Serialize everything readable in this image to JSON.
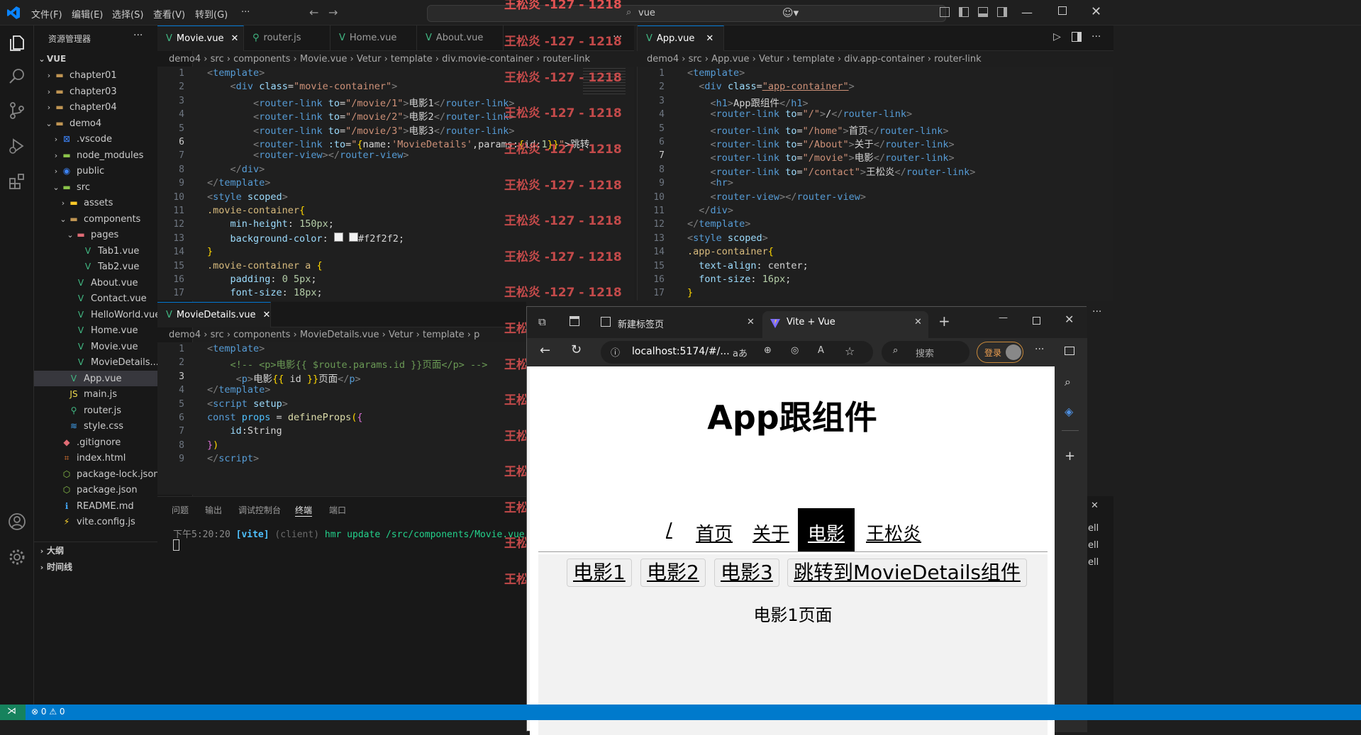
{
  "titlebar": {
    "menus": [
      "文件(F)",
      "编辑(E)",
      "选择(S)",
      "查看(V)",
      "转到(G)",
      "···"
    ],
    "search_text": "vue",
    "watermark_top": "王松炎 -127 - 1218"
  },
  "sidebar": {
    "title": "资源管理器",
    "root": "VUE",
    "items": [
      {
        "label": "chapter01"
      },
      {
        "label": "chapter03"
      },
      {
        "label": "chapter04"
      },
      {
        "label": "demo4"
      },
      {
        "label": ".vscode"
      },
      {
        "label": "node_modules"
      },
      {
        "label": "public"
      },
      {
        "label": "src"
      },
      {
        "label": "assets"
      },
      {
        "label": "components"
      },
      {
        "label": "pages"
      },
      {
        "label": "Tab1.vue"
      },
      {
        "label": "Tab2.vue"
      },
      {
        "label": "About.vue"
      },
      {
        "label": "Contact.vue"
      },
      {
        "label": "HelloWorld.vue"
      },
      {
        "label": "Home.vue"
      },
      {
        "label": "Movie.vue"
      },
      {
        "label": "MovieDetails...."
      },
      {
        "label": "App.vue"
      },
      {
        "label": "main.js"
      },
      {
        "label": "router.js"
      },
      {
        "label": "style.css"
      },
      {
        "label": ".gitignore"
      },
      {
        "label": "index.html"
      },
      {
        "label": "package-lock.json"
      },
      {
        "label": "package.json"
      },
      {
        "label": "README.md"
      },
      {
        "label": "vite.config.js"
      }
    ],
    "outline": "大纲",
    "timeline": "时间线"
  },
  "editor_left": {
    "tabs": [
      "Movie.vue",
      "router.js",
      "Home.vue",
      "About.vue"
    ],
    "breadcrumb": [
      "demo4",
      "src",
      "components",
      "Movie.vue",
      "Vetur",
      "template",
      "div.movie-container",
      "router-link"
    ]
  },
  "editor_right": {
    "tabs": [
      "App.vue"
    ],
    "breadcrumb": [
      "demo4",
      "src",
      "App.vue",
      "Vetur",
      "template",
      "div.app-container",
      "router-link"
    ]
  },
  "editor_bottom": {
    "tabs": [
      "MovieDetails.vue"
    ],
    "breadcrumb": [
      "demo4",
      "src",
      "components",
      "MovieDetails.vue",
      "Vetur",
      "template",
      "p"
    ]
  },
  "panel": {
    "tabs": [
      "问题",
      "输出",
      "调试控制台",
      "终端",
      "端口"
    ],
    "terminal_time": "下午5:20:20",
    "terminal_tag": "[vite]",
    "terminal_client": "(client)",
    "terminal_msg": "hmr update /src/components/Movie.vue (x",
    "right_items": [
      "ell",
      "ell",
      "ell"
    ]
  },
  "status": {
    "errors": "0",
    "warnings": "0"
  },
  "watermark": "王松炎 -127 - 1218",
  "browser": {
    "tab1": "新建标签页",
    "tab2": "Vite + Vue",
    "url": "localhost:5174/#/...",
    "search_placeholder": "搜索",
    "login": "登录",
    "page_title": "App跟组件",
    "nav": [
      "/",
      "首页",
      "关于",
      "电影",
      "王松炎"
    ],
    "sub_links": [
      "电影1",
      "电影2",
      "电影3",
      "跳转到MovieDetails组件"
    ],
    "content": "电影1页面"
  },
  "colors": {
    "accent": "#0078d4",
    "status": "#007acc",
    "watermark": "#e05252"
  }
}
